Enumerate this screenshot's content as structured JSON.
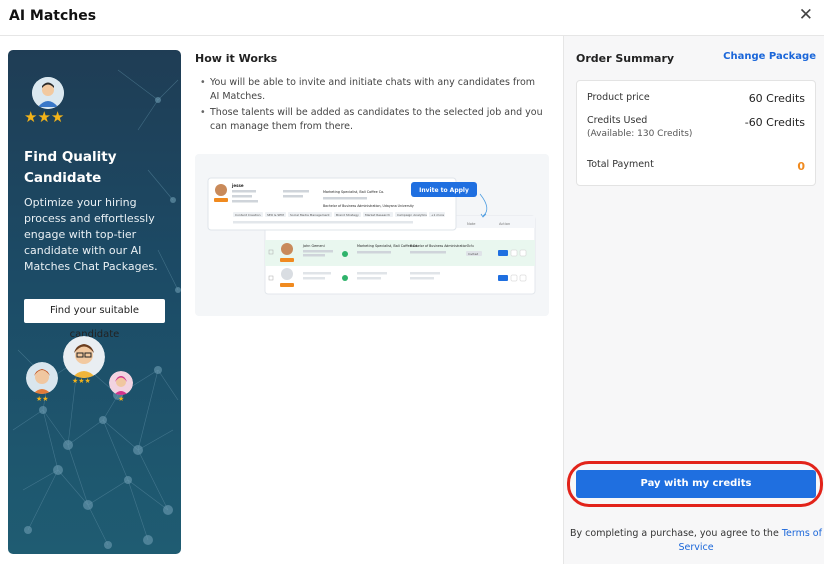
{
  "dialog": {
    "title": "AI Matches",
    "close_icon": "close-icon"
  },
  "promo": {
    "heading": "Find Quality Candidate",
    "body": "Optimize your hiring process and effortlessly engage with top-tier candidate with our AI Matches Chat Packages.",
    "tag": "Find your suitable candidate",
    "stars": "★★★",
    "stars_2": "★★",
    "stars_3": "★★★",
    "stars_1": "★",
    "colors": {
      "background": "#1f4d66",
      "star": "#f3b319"
    }
  },
  "how_it_works": {
    "title": "How it Works",
    "items": [
      "You will be able to invite and initiate chats with any candidates from AI Matches.",
      "Those talents will be added as candidates to the selected job and you can manage them from there."
    ],
    "preview": {
      "invite_button": "Invite to Apply",
      "card_name": "jesse",
      "card_role": "Marketing Specialist, Bali Coffee Co.",
      "card_education": "Bachelor of Business Administration, Udayana University",
      "skills": [
        "Content Creation",
        "SEO & SEM",
        "Social Media Management",
        "Brand Strategy",
        "Market Research",
        "Campaign Analytics",
        "+1 more"
      ],
      "table_headers": [
        "Info",
        "Latest Position",
        "Education",
        "Note",
        "Action"
      ],
      "row_1": {
        "info": "John Gemeni",
        "position": "Marketing Specialist, Bali Coffee Co.",
        "education": "Bachelor of Business Administration",
        "note": "Tofu",
        "badge": "Invited"
      }
    }
  },
  "order_summary": {
    "title": "Order Summary",
    "change_package": "Change Package",
    "product_price_label": "Product price",
    "product_price_value": "60 Credits",
    "credits_used_label": "Credits Used",
    "credits_available": "(Available: 130 Credits)",
    "credits_used_value": "-60 Credits",
    "total_label": "Total Payment",
    "total_value": "0",
    "colors": {
      "link": "#1a66d9",
      "total": "#f08a1f",
      "button": "#1f6fe0",
      "highlight": "#e2231a"
    }
  },
  "pay_button": "Pay with my credits",
  "terms": {
    "prefix": "By completing a purchase, you agree to the ",
    "link": "Terms of Service"
  }
}
